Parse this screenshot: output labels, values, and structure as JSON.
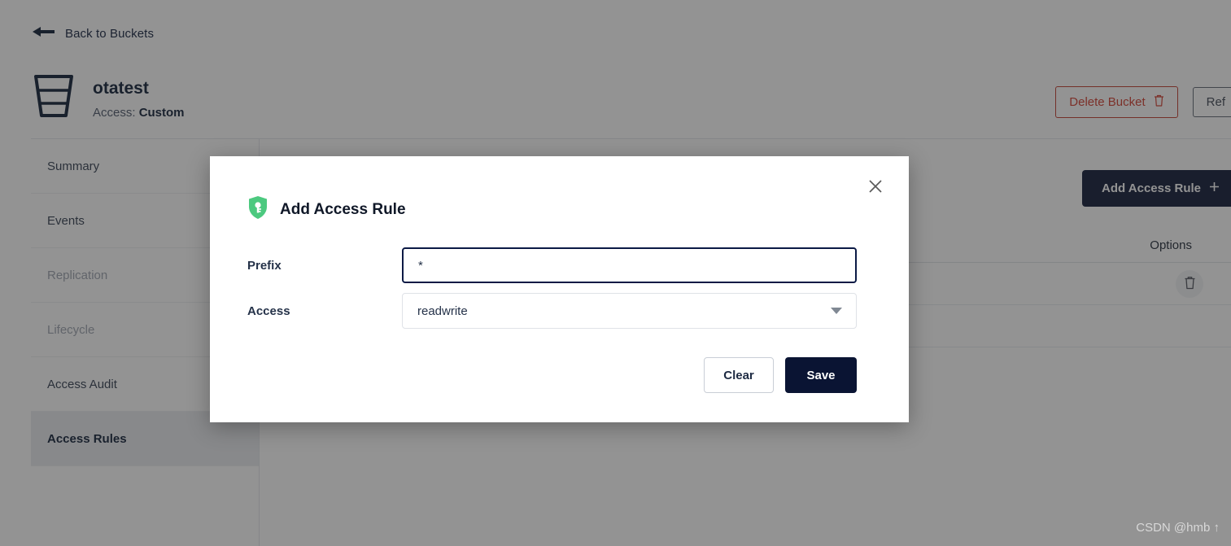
{
  "colors": {
    "brand_dark": "#0a1433",
    "danger": "#d0392b",
    "shield_green": "#4cc97f",
    "overlay": "#808080",
    "active_nav_bg": "#e8eaee"
  },
  "back_link": {
    "label": "Back to Buckets",
    "icon": "arrow-left-icon"
  },
  "bucket": {
    "icon": "bucket-icon",
    "name": "otatest",
    "access_label": "Access:",
    "access_value": "Custom"
  },
  "top_actions": {
    "delete_label": "Delete Bucket",
    "delete_icon": "trash-icon",
    "refresh_label": "Ref"
  },
  "sidebar": {
    "items": [
      {
        "label": "Summary",
        "state": "normal"
      },
      {
        "label": "Events",
        "state": "normal"
      },
      {
        "label": "Replication",
        "state": "disabled"
      },
      {
        "label": "Lifecycle",
        "state": "disabled"
      },
      {
        "label": "Access Audit",
        "state": "normal"
      },
      {
        "label": "Access Rules",
        "state": "active"
      }
    ]
  },
  "content": {
    "add_rule_label": "Add Access Rule",
    "add_rule_icon": "plus-icon",
    "table": {
      "columns": [
        "Options"
      ],
      "rows": [
        {
          "options_icon": "trash-icon"
        }
      ]
    }
  },
  "modal": {
    "icon": "shield-key-icon",
    "title": "Add Access Rule",
    "close_icon": "close-icon",
    "fields": {
      "prefix": {
        "label": "Prefix",
        "value": "*",
        "placeholder": ""
      },
      "access": {
        "label": "Access",
        "value": "readwrite",
        "caret_icon": "chevron-down-icon"
      }
    },
    "buttons": {
      "clear": "Clear",
      "save": "Save"
    }
  },
  "watermark": "CSDN @hmb ↑"
}
